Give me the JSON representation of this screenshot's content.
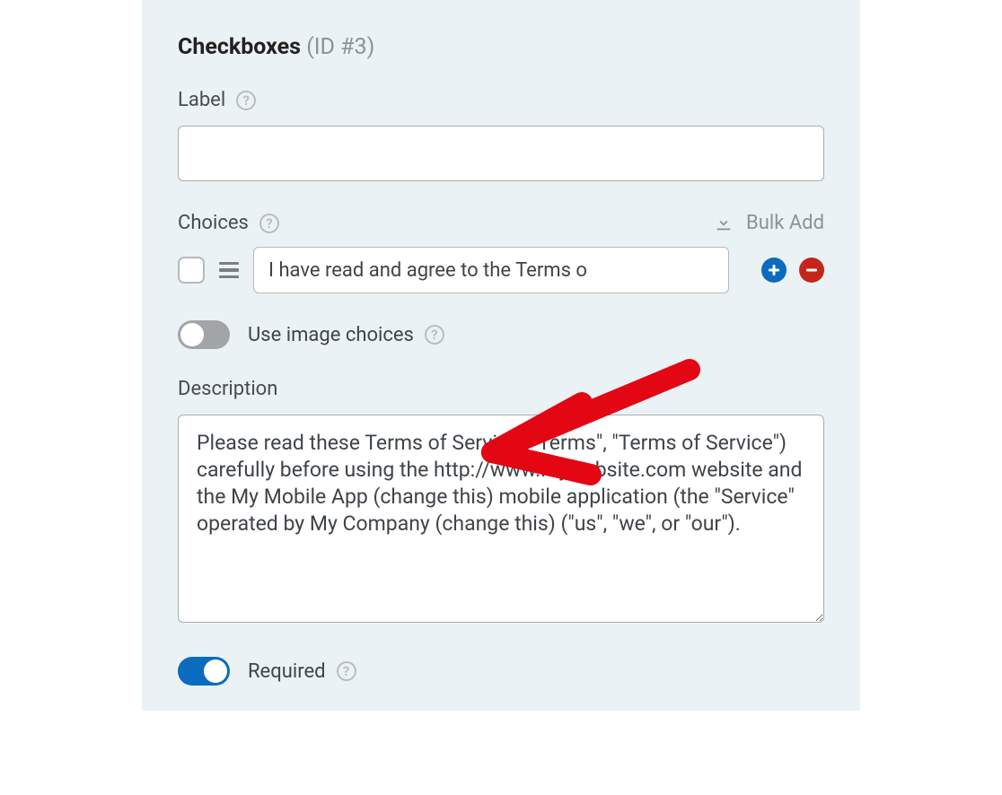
{
  "field": {
    "title": "Checkboxes",
    "id_prefix": "(ID #",
    "id_number": "3",
    "id_suffix": ")"
  },
  "label_section": {
    "heading": "Label",
    "value": ""
  },
  "choices_section": {
    "heading": "Choices",
    "bulk_add_label": "Bulk Add",
    "items": [
      {
        "text": "I have read and agree to the Terms o"
      }
    ]
  },
  "image_choices": {
    "label": "Use image choices",
    "enabled": false
  },
  "description_section": {
    "heading": "Description",
    "value": "Please read these Terms of Service (\"Terms\", \"Terms of Service\") carefully before using the http://www.mywebsite.com website and the My Mobile App (change this) mobile application (the \"Service\" operated by My Company (change this) (\"us\", \"we\", or \"our\")."
  },
  "required": {
    "label": "Required",
    "enabled": true
  }
}
